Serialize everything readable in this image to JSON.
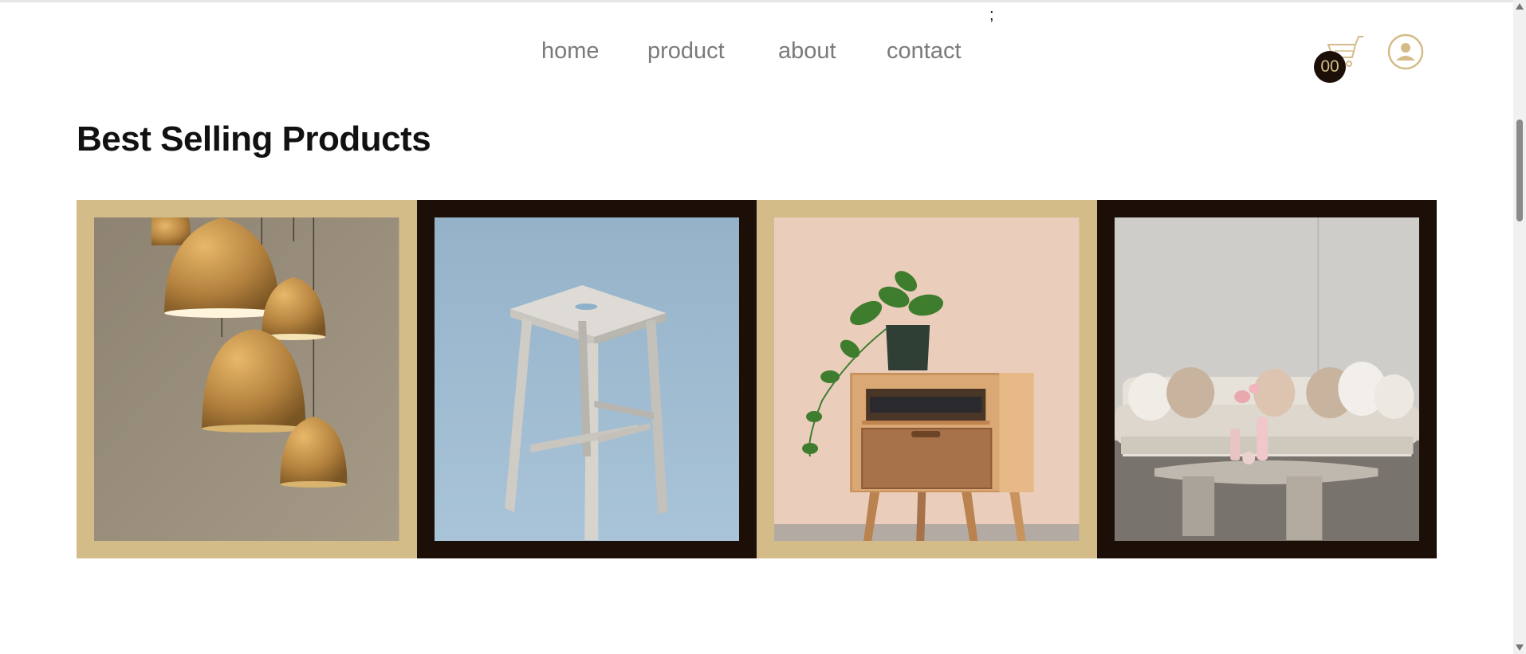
{
  "stray_text": ";",
  "nav": {
    "links": [
      {
        "label": "home"
      },
      {
        "label": "product"
      },
      {
        "label": "about"
      },
      {
        "label": "contact"
      }
    ]
  },
  "cart": {
    "icon": "cart-icon",
    "count": "00"
  },
  "user": {
    "icon": "user-circle-icon"
  },
  "section": {
    "title": "Best Selling Products"
  },
  "products": [
    {
      "image": "pendant-lamps-image",
      "frame_color": "#d4bc88"
    },
    {
      "image": "wooden-stool-image",
      "frame_color": "#1b0f08"
    },
    {
      "image": "nightstand-plant-image",
      "frame_color": "#d4bc88"
    },
    {
      "image": "sofa-table-image",
      "frame_color": "#1b0f08"
    }
  ],
  "colors": {
    "accent_gold": "#d4bc88",
    "accent_dark": "#1b0f08",
    "nav_text": "#7a7a7a"
  }
}
